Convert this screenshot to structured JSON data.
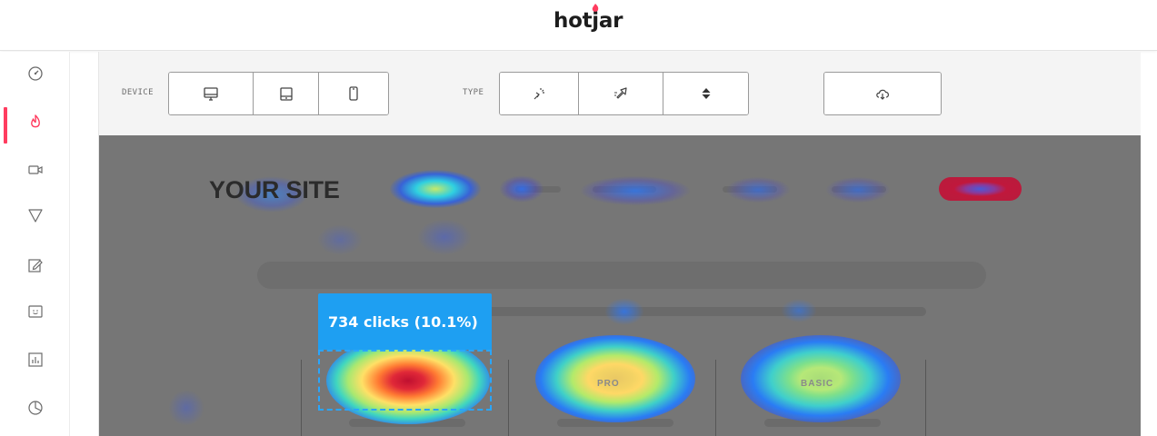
{
  "header": {
    "logo_text": "hotjar",
    "logo_color": "#1d1d1d",
    "logo_accent": "#ff3c5f"
  },
  "sidebar": {
    "accent": "#ff3c5f",
    "items": [
      {
        "icon": "dashboard-gauge-icon",
        "active": false
      },
      {
        "icon": "heatmap-flame-icon",
        "active": true
      },
      {
        "icon": "recordings-camera-icon",
        "active": false
      },
      {
        "icon": "funnels-icon",
        "active": false
      },
      {
        "icon": "forms-edit-icon",
        "active": false
      },
      {
        "icon": "feedback-poll-icon",
        "active": false
      },
      {
        "icon": "reports-chart-icon",
        "active": false
      },
      {
        "icon": "analytics-pie-icon",
        "active": false
      }
    ]
  },
  "toolbar": {
    "device_label": "DEVICE",
    "device_options": [
      "desktop-icon",
      "tablet-icon",
      "phone-icon"
    ],
    "type_label": "TYPE",
    "type_options": [
      "click-icon",
      "move-icon",
      "scroll-icon"
    ],
    "download_icon": "download-cloud-icon"
  },
  "heatmap": {
    "site_title": "YOUR SITE",
    "tooltip": "734 clicks (10.1%)",
    "card_labels": [
      "PRO",
      "BASIC"
    ],
    "tooltip_color": "#1e9ff2",
    "cta_color": "#b71c3c"
  }
}
